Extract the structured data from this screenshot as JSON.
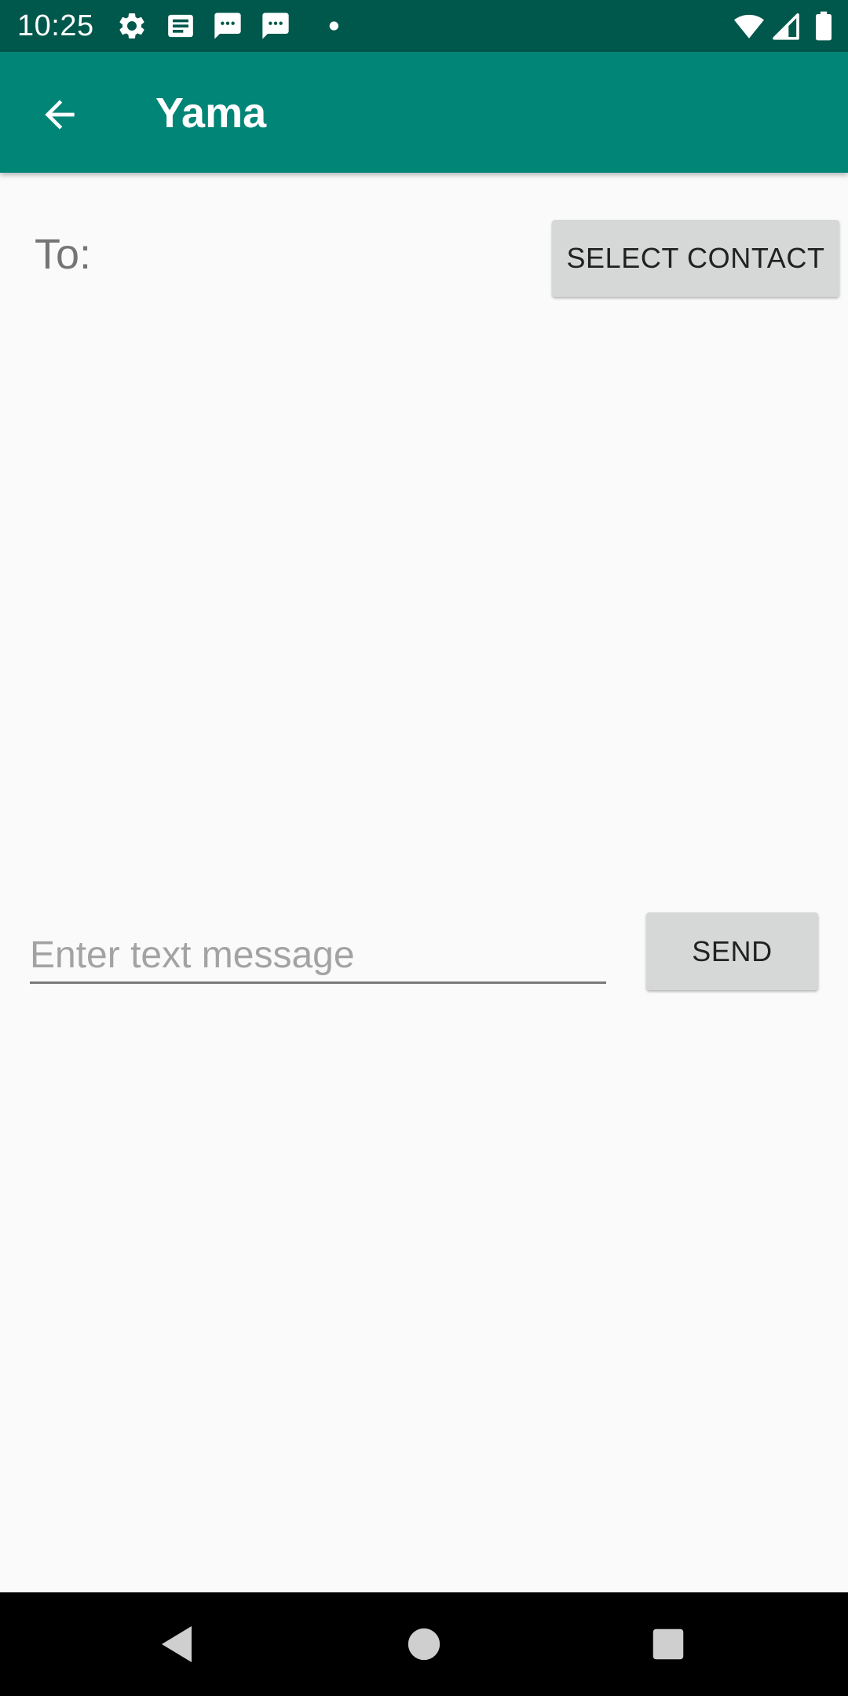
{
  "status_bar": {
    "time": "10:25",
    "left_icons": [
      "settings-icon",
      "newspaper-icon",
      "sms-icon",
      "sms-icon",
      "dot-icon"
    ],
    "right_icons": [
      "wifi-icon",
      "cell-signal-icon",
      "battery-icon"
    ],
    "background": "#00574b"
  },
  "app_bar": {
    "title": "Yama",
    "back_icon": "arrow-back-icon",
    "background": "#008577"
  },
  "compose": {
    "to_label": "To:",
    "select_contact_label": "SELECT CONTACT",
    "message_placeholder": "Enter text message",
    "message_value": "",
    "send_label": "SEND"
  },
  "nav_bar": {
    "buttons": [
      "back-triangle-icon",
      "home-circle-icon",
      "recents-square-icon"
    ]
  }
}
